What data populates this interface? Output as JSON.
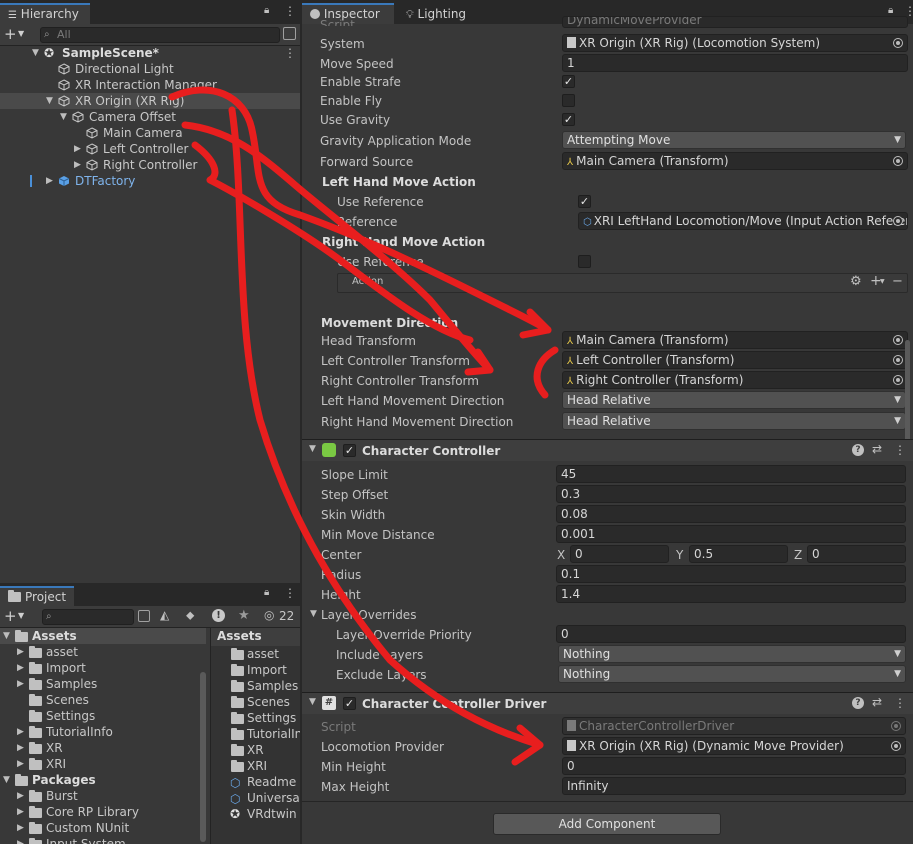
{
  "hierarchy": {
    "tab_label": "Hierarchy",
    "search_placeholder": "All",
    "items": [
      {
        "label": "SampleScene*"
      },
      {
        "label": "Directional Light"
      },
      {
        "label": "XR Interaction Manager"
      },
      {
        "label": "XR Origin (XR Rig)"
      },
      {
        "label": "Camera Offset"
      },
      {
        "label": "Main Camera"
      },
      {
        "label": "Left Controller"
      },
      {
        "label": "Right Controller"
      },
      {
        "label": "DTFactory"
      }
    ]
  },
  "project": {
    "tab_label": "Project",
    "hidden_count": "22",
    "left_tree": [
      {
        "label": "Assets"
      },
      {
        "label": "asset"
      },
      {
        "label": "Import"
      },
      {
        "label": "Samples"
      },
      {
        "label": "Scenes"
      },
      {
        "label": "Settings"
      },
      {
        "label": "TutorialInfo"
      },
      {
        "label": "XR"
      },
      {
        "label": "XRI"
      },
      {
        "label": "Packages"
      },
      {
        "label": "Burst"
      },
      {
        "label": "Core RP Library"
      },
      {
        "label": "Custom NUnit"
      },
      {
        "label": "Input System"
      }
    ],
    "right_header": "Assets",
    "right_items": [
      {
        "label": "asset"
      },
      {
        "label": "Import"
      },
      {
        "label": "Samples"
      },
      {
        "label": "Scenes"
      },
      {
        "label": "Settings"
      },
      {
        "label": "TutorialIn"
      },
      {
        "label": "XR"
      },
      {
        "label": "XRI"
      },
      {
        "label": "Readme"
      },
      {
        "label": "Universal"
      },
      {
        "label": "VRdtwin"
      }
    ]
  },
  "inspector": {
    "tab_label": "Inspector",
    "lighting_tab_label": "Lighting",
    "move": {
      "script_label": "Script",
      "script_value": "DynamicMoveProvider",
      "system_label": "System",
      "system_value": "XR Origin (XR Rig) (Locomotion System)",
      "move_speed_label": "Move Speed",
      "move_speed_value": "1",
      "enable_strafe_label": "Enable Strafe",
      "enable_fly_label": "Enable Fly",
      "use_gravity_label": "Use Gravity",
      "gravity_mode_label": "Gravity Application Mode",
      "gravity_mode_value": "Attempting Move",
      "forward_source_label": "Forward Source",
      "forward_source_value": "Main Camera (Transform)",
      "left_action_header": "Left Hand Move Action",
      "left_use_reference_label": "Use Reference",
      "left_reference_label": "Reference",
      "left_reference_value": "XRI LeftHand Locomotion/Move (Input Action Reference)",
      "right_action_header": "Right Hand Move Action",
      "right_use_reference_label": "Use Reference",
      "action_label": "Action",
      "movement_direction_header": "Movement Direction",
      "head_transform_label": "Head Transform",
      "head_transform_value": "Main Camera (Transform)",
      "left_ctrl_transform_label": "Left Controller Transform",
      "left_ctrl_transform_value": "Left Controller (Transform)",
      "right_ctrl_transform_label": "Right Controller Transform",
      "right_ctrl_transform_value": "Right Controller (Transform)",
      "left_dir_label": "Left Hand Movement Direction",
      "left_dir_value": "Head Relative",
      "right_dir_label": "Right Hand Movement Direction",
      "right_dir_value": "Head Relative"
    },
    "character_controller": {
      "title": "Character Controller",
      "slope_limit_label": "Slope Limit",
      "slope_limit_value": "45",
      "step_offset_label": "Step Offset",
      "step_offset_value": "0.3",
      "skin_width_label": "Skin Width",
      "skin_width_value": "0.08",
      "min_move_label": "Min Move Distance",
      "min_move_value": "0.001",
      "center_label": "Center",
      "center_x_label": "X",
      "center_x": "0",
      "center_y_label": "Y",
      "center_y": "0.5",
      "center_z_label": "Z",
      "center_z": "0",
      "radius_label": "Radius",
      "radius_value": "0.1",
      "height_label": "Height",
      "height_value": "1.4",
      "layer_overrides_label": "Layer Overrides",
      "layer_priority_label": "Layer Override Priority",
      "layer_priority_value": "0",
      "include_layers_label": "Include Layers",
      "include_layers_value": "Nothing",
      "exclude_layers_label": "Exclude Layers",
      "exclude_layers_value": "Nothing"
    },
    "driver": {
      "title": "Character Controller Driver",
      "script_label": "Script",
      "script_value": "CharacterControllerDriver",
      "loco_label": "Locomotion Provider",
      "loco_value": "XR Origin (XR Rig) (Dynamic Move Provider)",
      "min_height_label": "Min Height",
      "min_height_value": "0",
      "max_height_label": "Max Height",
      "max_height_value": "Infinity"
    },
    "add_component_label": "Add Component"
  },
  "annotation_color": "#e81e1e"
}
